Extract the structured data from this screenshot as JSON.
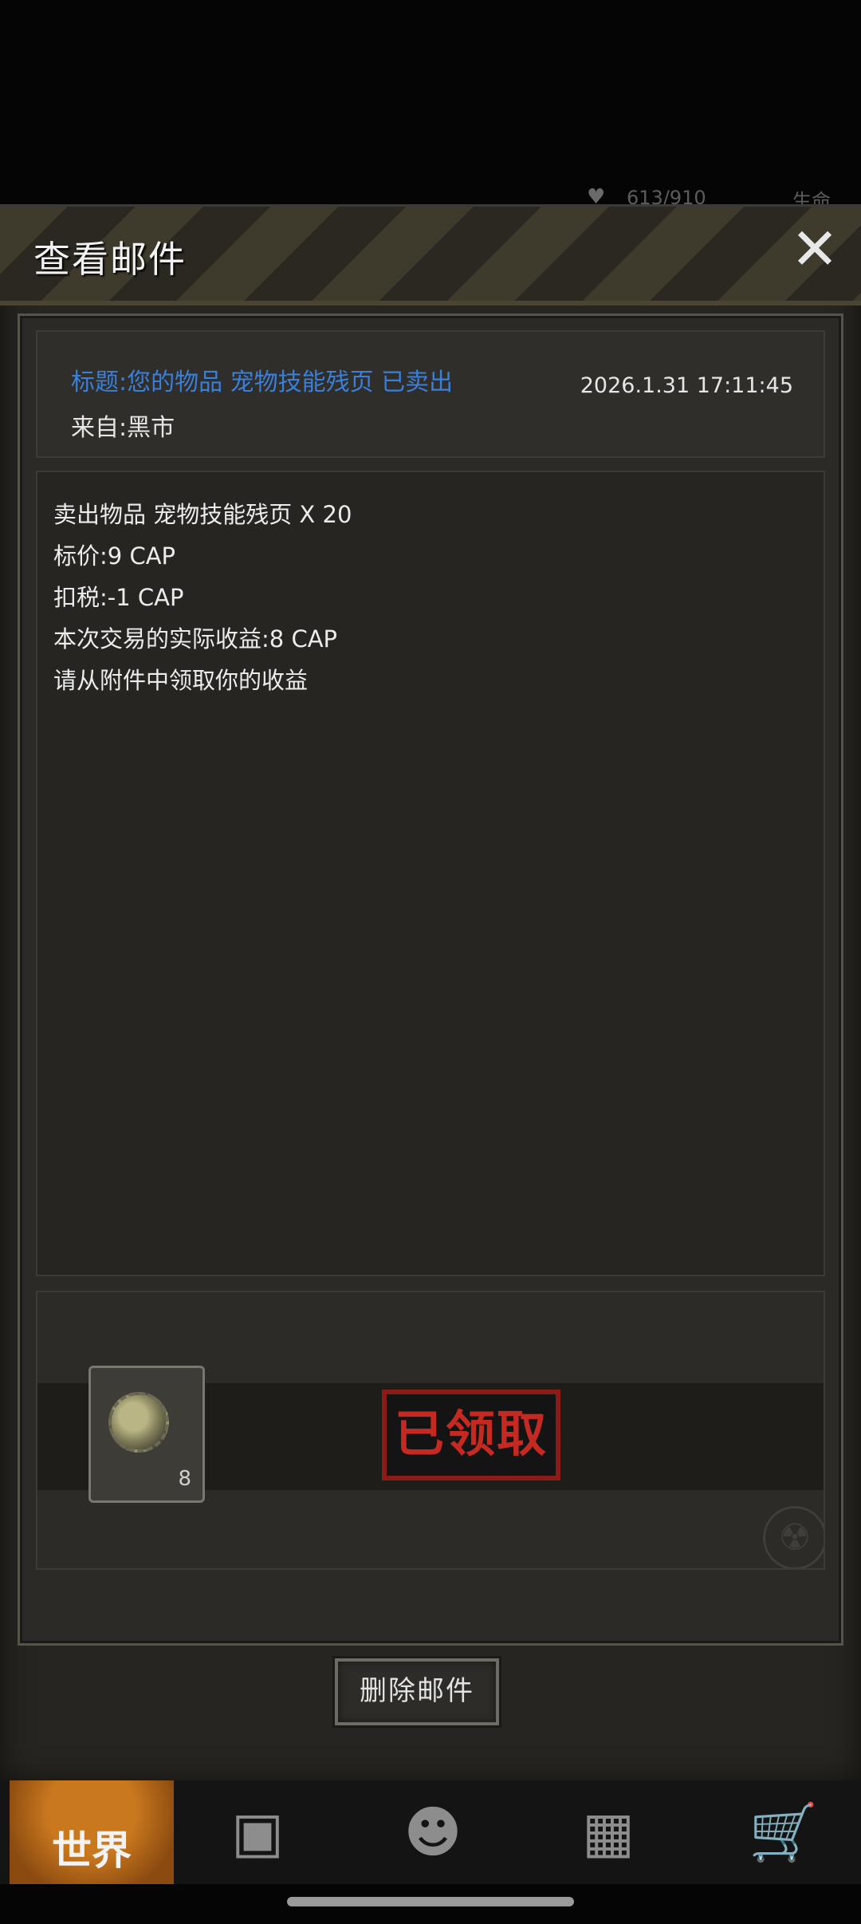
{
  "background_hud": {
    "count_text": "613/910",
    "life_text": "生命"
  },
  "dialog": {
    "title": "查看邮件",
    "close_icon": "close-icon"
  },
  "mail": {
    "subject": "标题:您的物品 宠物技能残页 已卖出",
    "sender": "来自:黑市",
    "date": "2026.1.31 17:11:45",
    "body_lines": [
      "卖出物品 宠物技能残页 X 20",
      "标价:9 CAP",
      "扣税:-1 CAP",
      "本次交易的实际收益:8 CAP",
      "请从附件中领取你的收益"
    ]
  },
  "attachment": {
    "item_icon": "bottlecap-icon",
    "quantity": "8",
    "status_stamp": "已领取"
  },
  "actions": {
    "delete_label": "删除邮件"
  },
  "bottom_nav": {
    "world_label": "世界",
    "items": [
      "world-icon",
      "backpack-icon",
      "character-icon",
      "device-icon",
      "shop-cart-icon"
    ]
  },
  "colors": {
    "subject_blue": "#3a7fd9",
    "stamp_red": "#c42a22",
    "world_orange": "#c9781e"
  }
}
